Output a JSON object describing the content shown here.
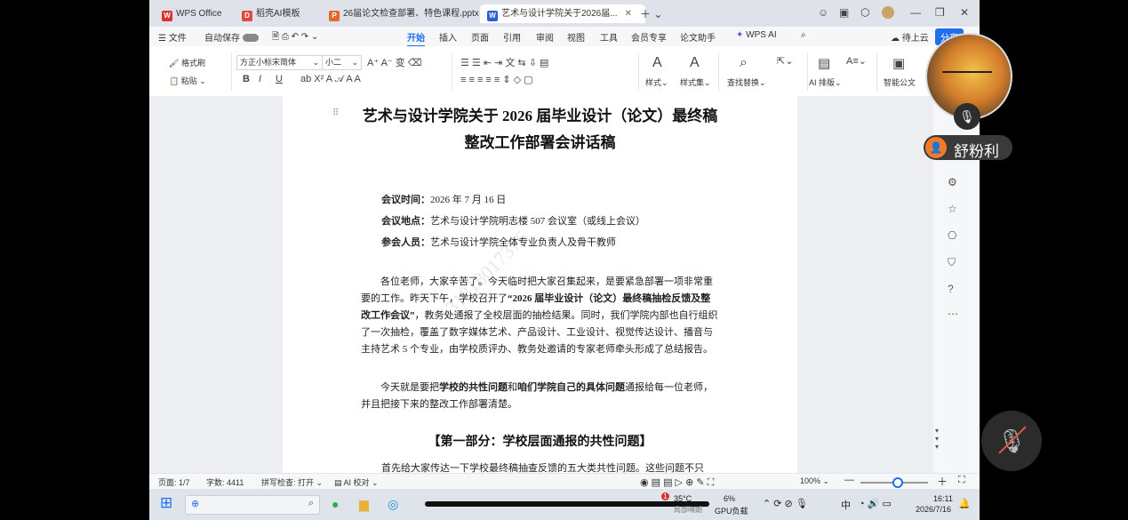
{
  "tabs": [
    {
      "label": "WPS Office",
      "icon": "wps-logo-icon",
      "color": "#d9332b"
    },
    {
      "label": "稻壳AI模板",
      "icon": "docer-icon",
      "color": "#e0483a"
    },
    {
      "label": "26届论文检查部署、特色课程.pptx",
      "icon": "ppt-icon",
      "color": "#e36a2b"
    },
    {
      "label": "艺术与设计学院关于2026届...",
      "icon": "word-icon",
      "color": "#2b62d8"
    }
  ],
  "menus": [
    "文件",
    "自动保存",
    "开始",
    "插入",
    "页面",
    "引用",
    "审阅",
    "视图",
    "工具",
    "会员专享",
    "论文助手",
    "WPS AI"
  ],
  "menu_active": "开始",
  "top_right": {
    "cloud": "待上云",
    "share": "分享"
  },
  "ribbon": {
    "format_brush": "格式刷",
    "paste": "粘贴",
    "font_name": "方正小标宋简体",
    "font_size": "小二",
    "styles": "样式",
    "style_set": "样式集",
    "find_replace": "查找替换",
    "ai_layout": "AI 排版",
    "smart_doc": "智能公文"
  },
  "document": {
    "title_line1": "艺术与设计学院关于 2026 届毕业设计（论文）最终稿",
    "title_line2": "整改工作部署会讲话稿",
    "meeting_time_label": "会议时间：",
    "meeting_time": "2026 年 7 月 16 日",
    "meeting_place_label": "会议地点：",
    "meeting_place": "艺术与设计学院明志楼 507 会议室（或线上会议）",
    "attendees_label": "参会人员：",
    "attendees": "艺术与设计学院全体专业负责人及骨干教师",
    "para1_a": "各位老师，大家辛苦了。今天临时把大家召集起来，是要紧急部署一项非常重要的工作。昨天下午，学校召开了",
    "para1_b": "“2026 届毕业设计（论文）最终稿抽检反馈及整改工作会议”",
    "para1_c": "，教务处通报了全校层面的抽检结果。同时，我们学院内部也自行组织了一次抽检，覆盖了数字媒体艺术、产品设计、工业设计、视觉传达设计、播音与主持艺术 5 个专业，由学校质评办、教务处邀请的专家老师牵头形成了总结报告。",
    "para2_a": "今天就是要把",
    "para2_b": "学校的共性问题",
    "para2_c": "和",
    "para2_d": "咱们学院自己的具体问题",
    "para2_e": "通报给每一位老师，并且把接下来的整改工作部署清楚。",
    "section1": "【第一部分：学校层面通报的共性问题】",
    "last_line": "首先给大家传达一下学校最终稿抽查反馈的五大类共性问题。这些问题不只",
    "watermark": "131818017376"
  },
  "status_bar": {
    "page": "页面: 1/7",
    "words": "字数: 4411",
    "spell": "拼写检查: 打开",
    "ai_check": "AI 校对",
    "zoom": "100%",
    "zoom_level": 0.5
  },
  "taskbar": {
    "weather_temp": "35°C",
    "weather_sub": "局部晴朗",
    "weather_badge": "1",
    "gpu_pct": "6%",
    "gpu_label": "GPU负载",
    "ime": "中",
    "time": "16:11",
    "date": "2026/7/16"
  },
  "meeting": {
    "participant_name": "舒粉利"
  }
}
